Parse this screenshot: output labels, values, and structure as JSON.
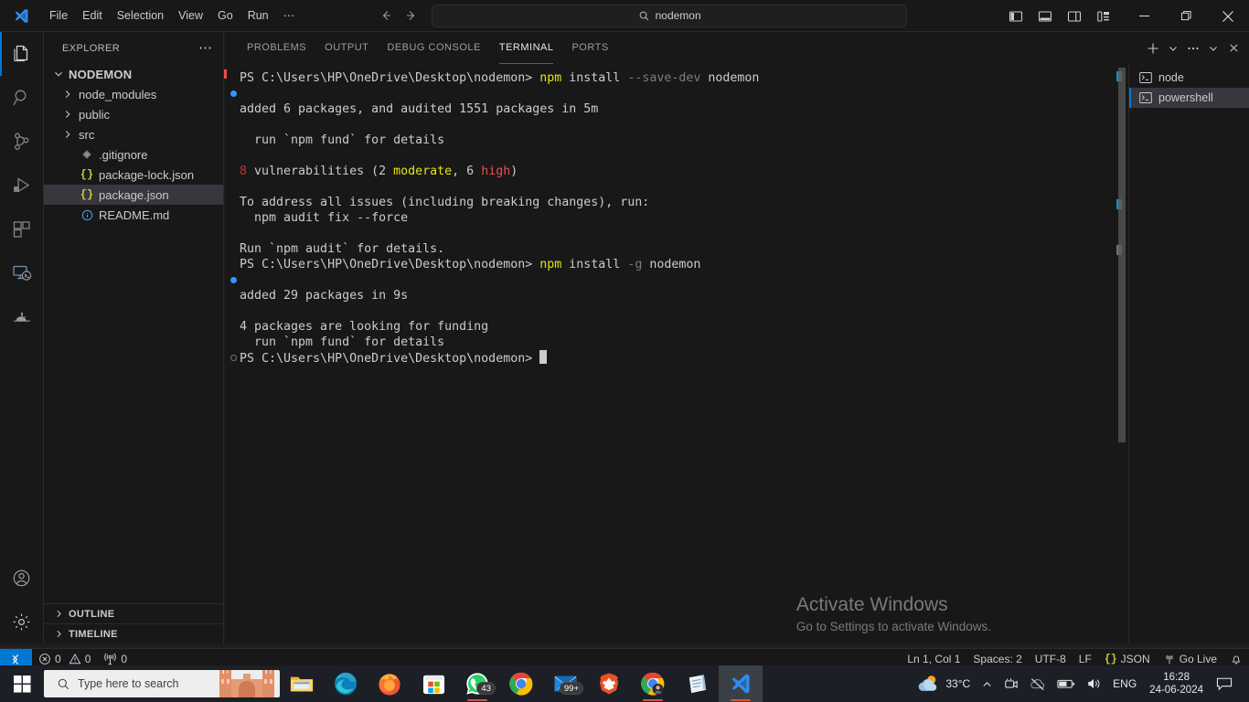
{
  "titlebar": {
    "logo_icon": "vscode-logo-icon",
    "menus": [
      "File",
      "Edit",
      "Selection",
      "View",
      "Go",
      "Run",
      "⋯"
    ],
    "back_icon": "arrow-left-icon",
    "forward_icon": "arrow-right-icon",
    "command_center": {
      "icon": "search-icon",
      "text": "nodemon"
    },
    "layout_buttons": [
      {
        "name": "toggle-primary-sidebar",
        "icon": "layout-sidebar-left-icon"
      },
      {
        "name": "toggle-panel",
        "icon": "layout-panel-icon"
      },
      {
        "name": "toggle-secondary-sidebar",
        "icon": "layout-sidebar-right-icon"
      },
      {
        "name": "customize-layout",
        "icon": "layout-customize-icon"
      }
    ],
    "window_controls": [
      {
        "name": "minimize-button",
        "icon": "minimize-icon"
      },
      {
        "name": "maximize-button",
        "icon": "restore-icon"
      },
      {
        "name": "close-button",
        "icon": "close-icon"
      }
    ]
  },
  "activitybar": {
    "items": [
      {
        "name": "explorer",
        "icon": "files-icon",
        "active": true
      },
      {
        "name": "search",
        "icon": "search-icon",
        "active": false
      },
      {
        "name": "source-control",
        "icon": "source-control-icon",
        "active": false
      },
      {
        "name": "run-and-debug",
        "icon": "run-debug-icon",
        "active": false
      },
      {
        "name": "extensions",
        "icon": "extensions-icon",
        "active": false
      },
      {
        "name": "remote-explorer",
        "icon": "remote-explorer-icon",
        "active": false
      },
      {
        "name": "aladdin-lamp",
        "icon": "lamp-icon",
        "active": false
      }
    ],
    "bottom_items": [
      {
        "name": "accounts",
        "icon": "account-icon"
      },
      {
        "name": "manage-settings",
        "icon": "gear-icon"
      }
    ]
  },
  "sidebar": {
    "title": "EXPLORER",
    "more_actions_icon": "ellipsis-icon",
    "root": {
      "label": "NODEMON",
      "expanded": true,
      "chevron": "chevron-down-icon"
    },
    "files": [
      {
        "label": "node_modules",
        "type": "folder",
        "icon": "chevron-right-icon",
        "selected": false
      },
      {
        "label": "public",
        "type": "folder",
        "icon": "chevron-right-icon",
        "selected": false
      },
      {
        "label": "src",
        "type": "folder",
        "icon": "chevron-right-icon",
        "selected": false
      },
      {
        "label": ".gitignore",
        "type": "file",
        "icon": "gitignore-icon",
        "selected": false
      },
      {
        "label": "package-lock.json",
        "type": "file",
        "icon": "json-icon",
        "selected": false
      },
      {
        "label": "package.json",
        "type": "file",
        "icon": "json-icon",
        "selected": true
      },
      {
        "label": "README.md",
        "type": "file",
        "icon": "info-icon",
        "selected": false
      }
    ],
    "sections": [
      {
        "label": "OUTLINE",
        "chevron": "chevron-right-icon"
      },
      {
        "label": "TIMELINE",
        "chevron": "chevron-right-icon"
      }
    ]
  },
  "panel": {
    "tabs": [
      {
        "label": "PROBLEMS",
        "active": false
      },
      {
        "label": "OUTPUT",
        "active": false
      },
      {
        "label": "DEBUG CONSOLE",
        "active": false
      },
      {
        "label": "TERMINAL",
        "active": true
      },
      {
        "label": "PORTS",
        "active": false
      }
    ],
    "actions": [
      {
        "name": "new-terminal-button",
        "icon": "plus-icon"
      },
      {
        "name": "terminal-profile-dropdown",
        "icon": "chevron-down-icon"
      },
      {
        "name": "panel-more-actions",
        "icon": "ellipsis-icon"
      },
      {
        "name": "hide-panel-button",
        "icon": "chevron-down-icon"
      },
      {
        "name": "close-panel-button",
        "icon": "close-icon"
      }
    ],
    "terminal_list": [
      {
        "label": "node",
        "icon": "terminal-icon",
        "active": false
      },
      {
        "label": "powershell",
        "icon": "terminal-icon",
        "active": true
      }
    ],
    "terminal_lines": [
      {
        "gutter": "none",
        "segments": [
          {
            "t": "PS C:\\Users\\HP\\OneDrive\\Desktop\\nodemon> ",
            "c": "white"
          },
          {
            "t": "npm",
            "c": "yellow"
          },
          {
            "t": " install ",
            "c": "white"
          },
          {
            "t": "--save-dev",
            "c": "dim"
          },
          {
            "t": " nodemon",
            "c": "white"
          }
        ]
      },
      {
        "gutter": "dot-blue",
        "segments": []
      },
      {
        "gutter": "none",
        "segments": [
          {
            "t": "added 6 packages, and audited 1551 packages in 5m",
            "c": "white"
          }
        ]
      },
      {
        "gutter": "none",
        "segments": []
      },
      {
        "gutter": "none",
        "segments": [
          {
            "t": "  run `npm fund` for details",
            "c": "white"
          }
        ]
      },
      {
        "gutter": "none",
        "segments": []
      },
      {
        "gutter": "none",
        "segments": [
          {
            "t": "8",
            "c": "red"
          },
          {
            "t": " vulnerabilities (2 ",
            "c": "white"
          },
          {
            "t": "moderate",
            "c": "yellow"
          },
          {
            "t": ", 6 ",
            "c": "white"
          },
          {
            "t": "high",
            "c": "brightred"
          },
          {
            "t": ")",
            "c": "white"
          }
        ]
      },
      {
        "gutter": "none",
        "segments": []
      },
      {
        "gutter": "none",
        "segments": [
          {
            "t": "To address all issues (including breaking changes), run:",
            "c": "white"
          }
        ]
      },
      {
        "gutter": "none",
        "segments": [
          {
            "t": "  npm audit fix --force",
            "c": "white"
          }
        ]
      },
      {
        "gutter": "none",
        "segments": []
      },
      {
        "gutter": "none",
        "segments": [
          {
            "t": "Run `npm audit` for details.",
            "c": "white"
          }
        ]
      },
      {
        "gutter": "none",
        "segments": [
          {
            "t": "PS C:\\Users\\HP\\OneDrive\\Desktop\\nodemon> ",
            "c": "white"
          },
          {
            "t": "npm",
            "c": "yellow"
          },
          {
            "t": " install ",
            "c": "white"
          },
          {
            "t": "-g",
            "c": "dim"
          },
          {
            "t": " nodemon",
            "c": "white"
          }
        ]
      },
      {
        "gutter": "dot-blue",
        "segments": []
      },
      {
        "gutter": "none",
        "segments": [
          {
            "t": "added 29 packages in 9s",
            "c": "white"
          }
        ]
      },
      {
        "gutter": "none",
        "segments": []
      },
      {
        "gutter": "none",
        "segments": [
          {
            "t": "4 packages are looking for funding",
            "c": "white"
          }
        ]
      },
      {
        "gutter": "none",
        "segments": [
          {
            "t": "  run `npm fund` for details",
            "c": "white"
          }
        ]
      },
      {
        "gutter": "dot-ring",
        "segments": [
          {
            "t": "PS C:\\Users\\HP\\OneDrive\\Desktop\\nodemon> ",
            "c": "white"
          },
          {
            "t": "█",
            "c": "cursor"
          }
        ]
      }
    ]
  },
  "watermark": {
    "line1": "Activate Windows",
    "line2": "Go to Settings to activate Windows."
  },
  "statusbar": {
    "remote_icon": "remote-indicator-icon",
    "left": [
      {
        "name": "problems-status",
        "icon": "error-icon",
        "errors": "0",
        "warn_icon": "warning-icon",
        "warnings": "0"
      },
      {
        "name": "ports-status",
        "icon": "radio-tower-icon",
        "count": "0"
      }
    ],
    "right": [
      {
        "name": "editor-position",
        "label": "Ln 1, Col 1"
      },
      {
        "name": "editor-indentation",
        "label": "Spaces: 2"
      },
      {
        "name": "editor-encoding",
        "label": "UTF-8"
      },
      {
        "name": "editor-eol",
        "label": "LF"
      },
      {
        "name": "editor-language",
        "label": "JSON",
        "icon": "json-icon"
      },
      {
        "name": "go-live",
        "label": "Go Live",
        "icon": "broadcast-icon"
      },
      {
        "name": "notifications",
        "label": "",
        "icon": "bell-icon"
      }
    ]
  },
  "taskbar": {
    "start_icon": "windows-start-icon",
    "search": {
      "icon": "search-icon",
      "placeholder": "Type here to search"
    },
    "apps": [
      {
        "name": "file-explorer",
        "icon": "folder-icon",
        "badge": "",
        "running": false,
        "active": false
      },
      {
        "name": "microsoft-edge",
        "icon": "edge-icon",
        "badge": "",
        "running": true,
        "active": false
      },
      {
        "name": "firefox",
        "icon": "firefox-icon",
        "badge": "",
        "running": false,
        "active": false
      },
      {
        "name": "microsoft-store",
        "icon": "store-icon",
        "badge": "",
        "running": false,
        "active": false
      },
      {
        "name": "whatsapp",
        "icon": "whatsapp-icon",
        "badge": "43",
        "running": true,
        "active": false
      },
      {
        "name": "google-chrome",
        "icon": "chrome-icon",
        "badge": "",
        "running": false,
        "active": false
      },
      {
        "name": "mail",
        "icon": "mail-icon",
        "badge": "99+",
        "running": false,
        "active": false
      },
      {
        "name": "brave-browser",
        "icon": "brave-icon",
        "badge": "",
        "running": false,
        "active": false
      },
      {
        "name": "chrome-profile",
        "icon": "chrome-profile-icon",
        "badge": "",
        "running": true,
        "active": false
      },
      {
        "name": "notepad",
        "icon": "notepad-icon",
        "badge": "",
        "running": false,
        "active": false
      },
      {
        "name": "visual-studio-code",
        "icon": "vscode-icon",
        "badge": "",
        "running": true,
        "active": true
      }
    ],
    "tray": {
      "weather": {
        "icon": "weather-partly-cloudy-icon",
        "text": "33°C"
      },
      "chevron_icon": "chevron-up-icon",
      "icons": [
        {
          "name": "camera-tray-icon",
          "icon": "camera-icon"
        },
        {
          "name": "onedrive-paused-icon",
          "icon": "cloud-slash-icon"
        },
        {
          "name": "battery-icon",
          "icon": "battery-icon"
        },
        {
          "name": "volume-icon",
          "icon": "speaker-icon"
        }
      ],
      "language": "ENG",
      "time": "16:28",
      "date": "24-06-2024",
      "action_center_icon": "action-center-icon"
    }
  },
  "colors": {
    "accent": "#0078d4",
    "panel_bg": "#181818",
    "selection": "#37373d",
    "terminal_yellow": "#e5e510",
    "terminal_red": "#cd3131",
    "terminal_bright_red": "#f14c4c",
    "taskbar_bg": "#1c1f26"
  }
}
